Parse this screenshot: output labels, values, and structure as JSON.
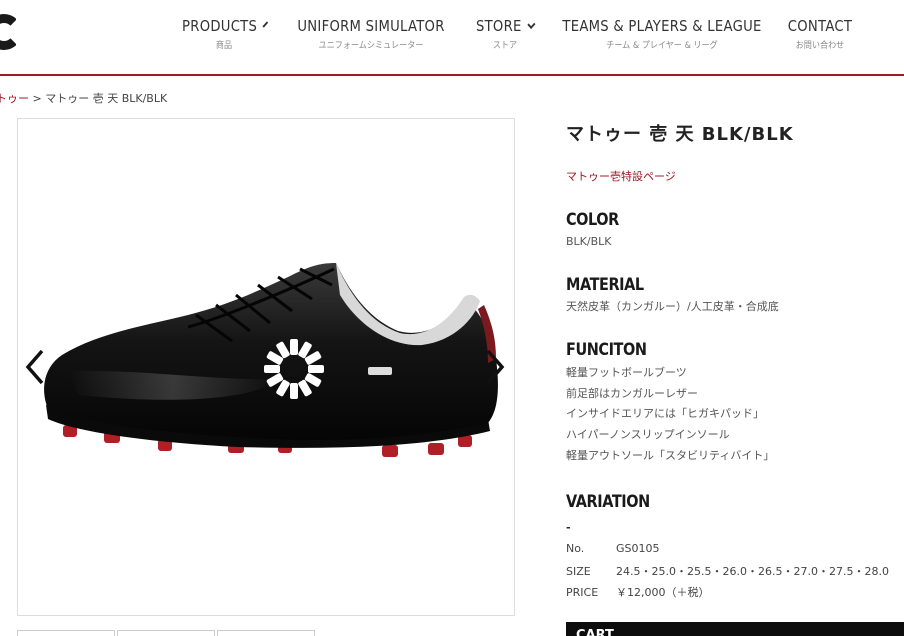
{
  "nav": {
    "items": [
      {
        "label": "PRODUCTS",
        "sub": "商品",
        "dropdown": true
      },
      {
        "label": "UNIFORM SIMULATOR",
        "sub": "ユニフォームシミュレーター",
        "dropdown": false
      },
      {
        "label": "STORE",
        "sub": "ストア",
        "dropdown": true
      },
      {
        "label": "TEAMS & PLAYERS & LEAGUE",
        "sub": "チーム & プレイヤー & リーグ",
        "dropdown": false
      },
      {
        "label": "CONTACT",
        "sub": "お問い合わせ",
        "dropdown": false
      }
    ]
  },
  "breadcrumb": {
    "link": "トゥー",
    "separator": ">",
    "current": "マトゥー 壱 天 BLK/BLK"
  },
  "product": {
    "title": "マトゥー 壱 天 BLK/BLK",
    "special_link": "マトゥー壱特設ページ",
    "color_heading": "COLOR",
    "color_value": "BLK/BLK",
    "material_heading": "MATERIAL",
    "material_value": "天然皮革（カンガルー）/人工皮革・合成底",
    "function_heading": "FUNCITON",
    "function_lines": [
      "軽量フットボールブーツ",
      "前足部はカンガルーレザー",
      "インサイドエリアには「ヒガキパッド」",
      "ハイパーノンスリップインソール",
      "軽量アウトソール「スタビリティバイト」"
    ],
    "variation_heading": "VARIATION",
    "variation_value": "-",
    "specs": [
      {
        "key": "No.",
        "value": "GS0105"
      },
      {
        "key": "SIZE",
        "value": "24.5・25.0・25.5・26.0・26.5・27.0・27.5・28.0"
      },
      {
        "key": "PRICE",
        "value": "￥12,000（＋税）"
      }
    ],
    "cart_label": "CART"
  },
  "colors": {
    "accent": "#9b1b24",
    "boot": "#111111",
    "studs": "#b01e26"
  },
  "icons": [
    "chevron-down-icon",
    "chevron-left-icon",
    "chevron-right-icon",
    "brand-logo-icon"
  ]
}
